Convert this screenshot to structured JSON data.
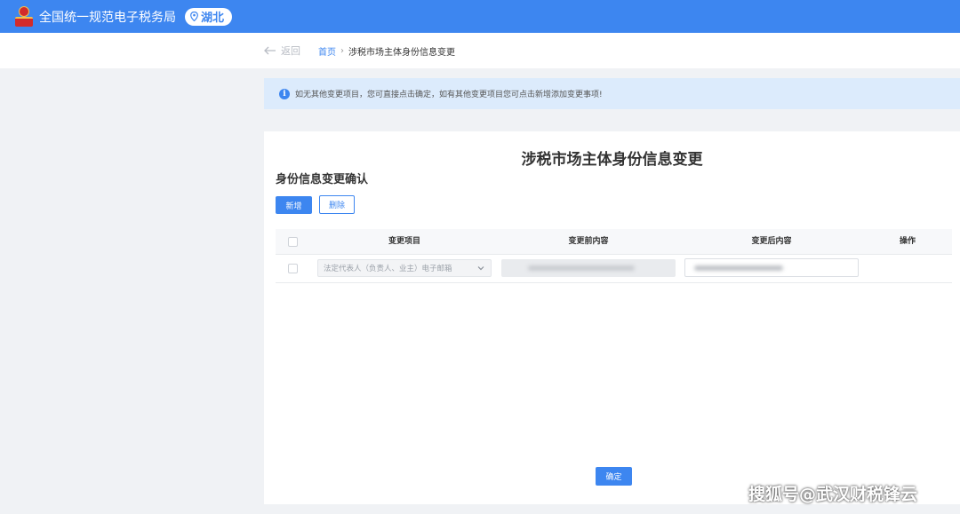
{
  "header": {
    "title": "全国统一规范电子税务局",
    "region": "湖北",
    "colors": {
      "bar": "#3d86f0",
      "emblem": "#d22b2b"
    }
  },
  "nav": {
    "back_label": "返回",
    "breadcrumb": {
      "home": "首页",
      "separator": "›",
      "current": "涉税市场主体身份信息变更"
    }
  },
  "notice": {
    "icon": "info-icon",
    "text": "如无其他变更项目，您可直接点击确定，如有其他变更项目您可点击新增添加变更事项!"
  },
  "panel": {
    "title": "涉税市场主体身份信息变更",
    "section_title": "身份信息变更确认",
    "add_label": "新增",
    "delete_label": "删除",
    "table": {
      "columns": [
        "变更项目",
        "变更前内容",
        "变更后内容",
        "操作"
      ],
      "rows": [
        {
          "item": "法定代表人（负责人、业主）电子邮箱",
          "before": "",
          "after": ""
        }
      ]
    },
    "confirm_label": "确定"
  },
  "watermark": "搜狐号@武汉财税锋云"
}
